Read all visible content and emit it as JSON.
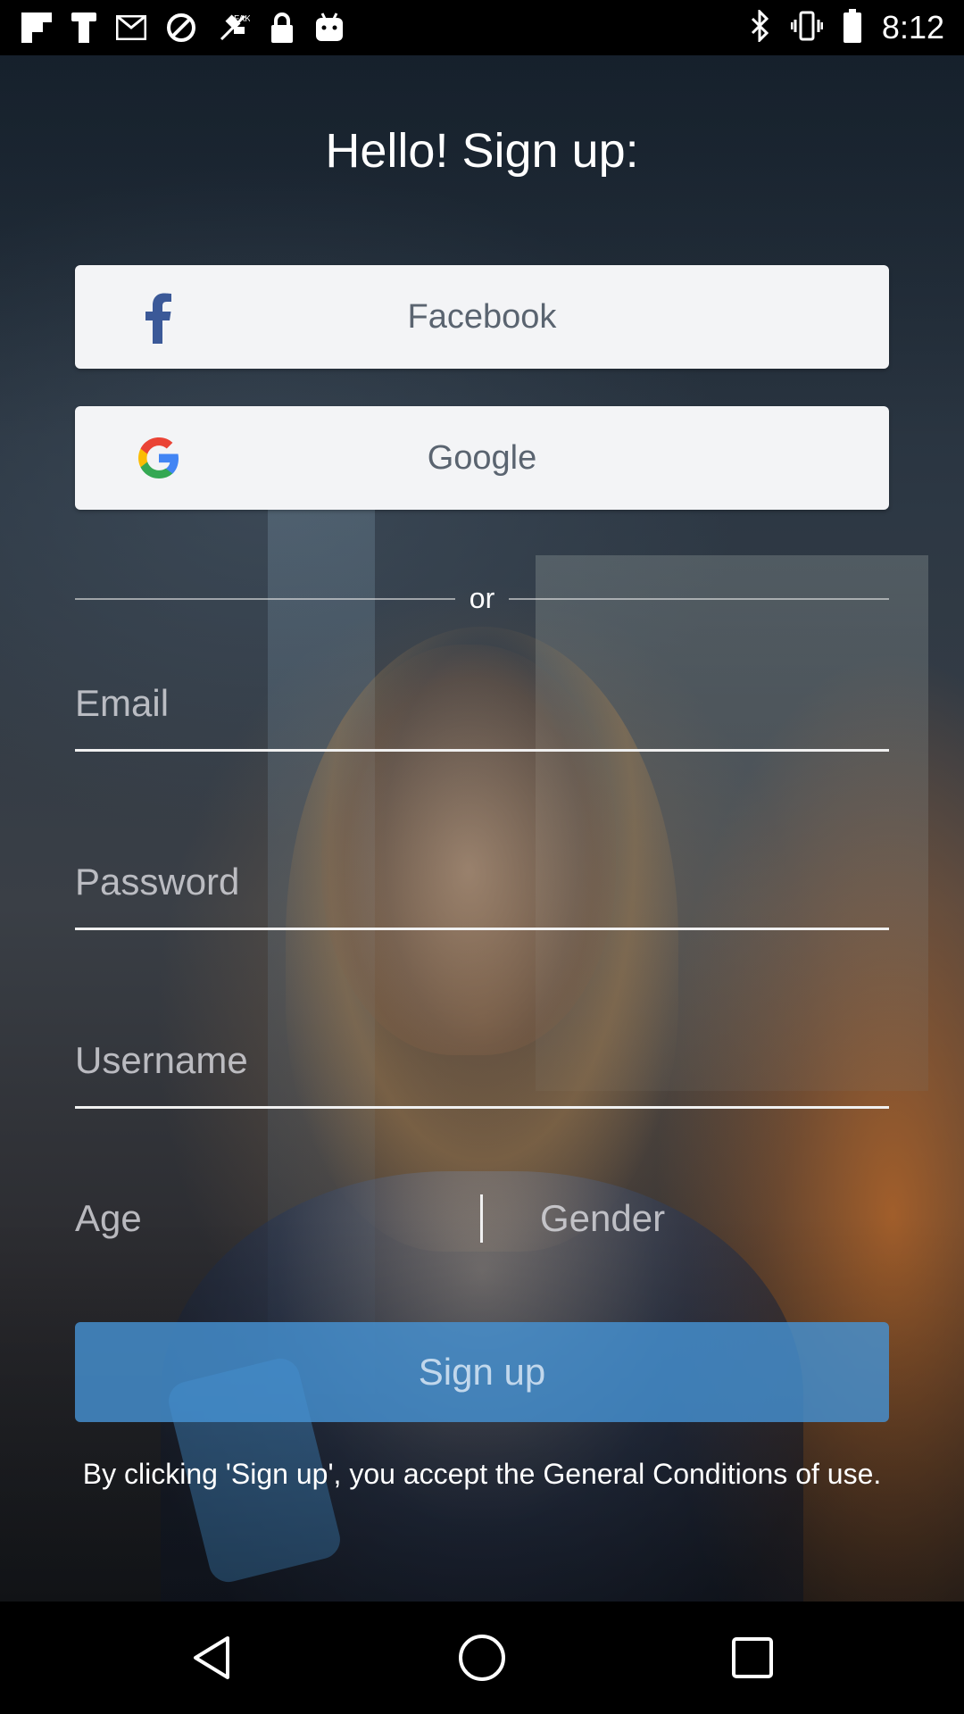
{
  "status_bar": {
    "time": "8:12",
    "left_icons": [
      "flipboard-icon",
      "navigation-icon",
      "mail-icon",
      "block-icon",
      "no-gps-icon",
      "lock-icon",
      "android-icon"
    ],
    "right_icons": [
      "bluetooth-icon",
      "vibrate-icon",
      "battery-icon"
    ]
  },
  "header": {
    "title": "Hello! Sign up:"
  },
  "social": {
    "facebook_label": "Facebook",
    "google_label": "Google"
  },
  "divider": {
    "or_text": "or"
  },
  "form": {
    "email_placeholder": "Email",
    "password_placeholder": "Password",
    "username_placeholder": "Username",
    "age_placeholder": "Age",
    "gender_placeholder": "Gender",
    "signup_label": "Sign up"
  },
  "footer": {
    "terms_text": "By clicking 'Sign up', you accept the General Conditions of use."
  },
  "colors": {
    "signup_button": "#4691d2",
    "facebook_blue": "#3b5998",
    "social_button_bg": "#f3f4f6"
  },
  "nav_bar": {
    "buttons": [
      "back-icon",
      "home-icon",
      "recents-icon"
    ]
  }
}
